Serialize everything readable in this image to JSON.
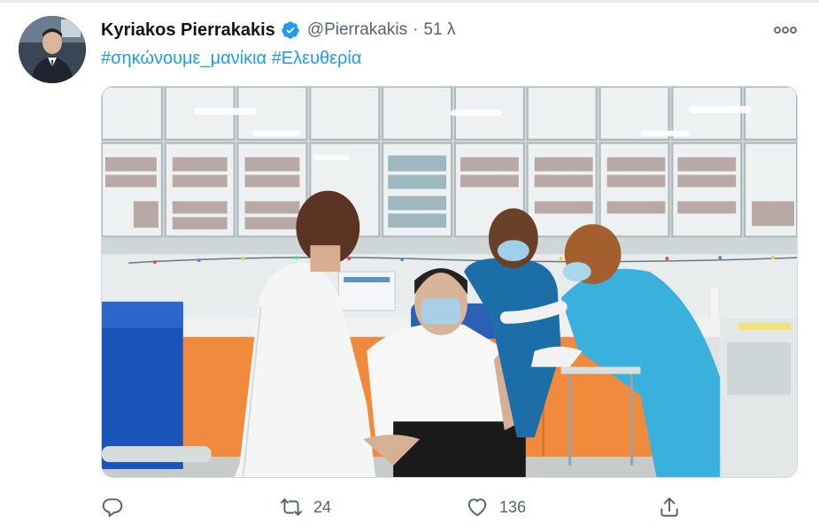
{
  "tweet": {
    "author": {
      "name": "Kyriakos Pierrakakis",
      "handle": "@Pierrakakis",
      "verified": true,
      "avatar_icon": "profile-photo"
    },
    "separator": "·",
    "timestamp": "51 λ",
    "text_hashtags": [
      "#σηκώνουμε_μανίκια",
      "#Ελευθερία"
    ],
    "media": {
      "type": "photo",
      "subject": "vaccination-in-clinic"
    },
    "more_icon": "ellipsis-icon",
    "actions": {
      "reply": {
        "icon": "reply-icon",
        "count": ""
      },
      "retweet": {
        "icon": "retweet-icon",
        "count": "24"
      },
      "like": {
        "icon": "heart-icon",
        "count": "136"
      },
      "share": {
        "icon": "share-icon",
        "count": ""
      }
    }
  },
  "colors": {
    "link": "#1d9bf0",
    "muted": "#536471",
    "text": "#0f1419",
    "verified": "#1d9bf0"
  }
}
